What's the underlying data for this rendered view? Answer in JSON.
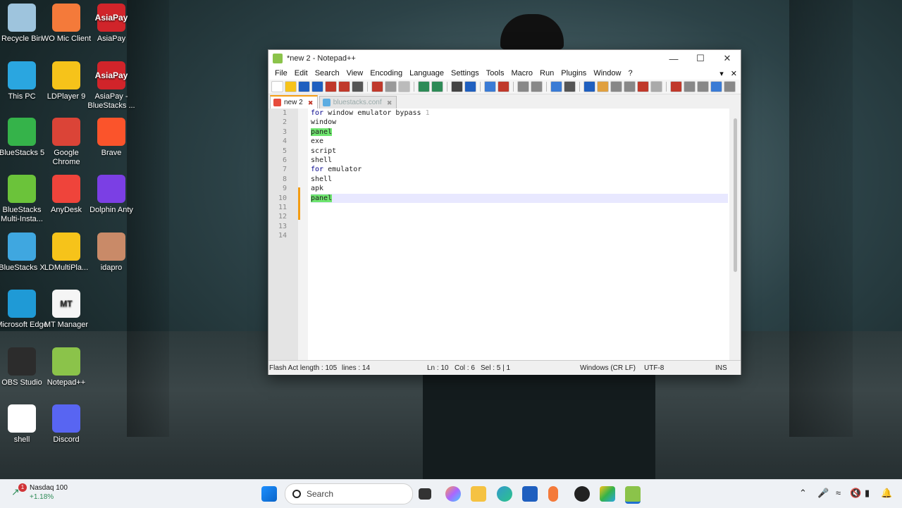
{
  "desktop": {
    "icons": [
      {
        "label": "Recycle Bin",
        "icon": "recycle-bin-icon",
        "color": "#9ec4dd"
      },
      {
        "label": "WO Mic Client",
        "icon": "wo-mic-icon",
        "color": "#f47a3a"
      },
      {
        "label": "AsiaPay",
        "icon": "asiapay-icon",
        "color": "#d1242a",
        "text": "AsiaPay"
      },
      {
        "label": "This PC",
        "icon": "this-pc-icon",
        "color": "#2aa6e0"
      },
      {
        "label": "LDPlayer 9",
        "icon": "ldplayer-icon",
        "color": "#f6c31a"
      },
      {
        "label": "AsiaPay - BlueStacks ...",
        "icon": "asiapay-bluestacks-icon",
        "color": "#d1242a",
        "text": "AsiaPay"
      },
      {
        "label": "BlueStacks 5",
        "icon": "bluestacks-icon",
        "color": "#35b34a"
      },
      {
        "label": "Google Chrome",
        "icon": "chrome-icon",
        "color": "#db4437"
      },
      {
        "label": "Brave",
        "icon": "brave-icon",
        "color": "#fb542b"
      },
      {
        "label": "BlueStacks Multi-Insta...",
        "icon": "bluestacks-multi-icon",
        "color": "#6bc33a"
      },
      {
        "label": "AnyDesk",
        "icon": "anydesk-icon",
        "color": "#ef443b"
      },
      {
        "label": "Dolphin Anty",
        "icon": "dolphin-anty-icon",
        "color": "#7b3fe4"
      },
      {
        "label": "BlueStacks X",
        "icon": "bluestacks-x-icon",
        "color": "#3fa7e0"
      },
      {
        "label": "LDMultiPla...",
        "icon": "ldmultiplayer-icon",
        "color": "#f6c31a"
      },
      {
        "label": "idapro",
        "icon": "idapro-icon",
        "color": "#c98a68"
      },
      {
        "label": "Microsoft Edge",
        "icon": "edge-icon",
        "color": "#1f9ad6"
      },
      {
        "label": "MT Manager",
        "icon": "mt-manager-icon",
        "color": "#f5f5f5",
        "text": "MT"
      },
      {
        "label": "OBS Studio",
        "icon": "obs-icon",
        "color": "#2c2c2c"
      },
      {
        "label": "Notepad++",
        "icon": "notepadpp-icon",
        "color": "#8bc34a"
      },
      {
        "label": "shell",
        "icon": "shell-file-icon",
        "color": "#ffffff"
      },
      {
        "label": "Discord",
        "icon": "discord-icon",
        "color": "#5865f2"
      }
    ]
  },
  "window": {
    "title": "*new 2 - Notepad++",
    "menu": [
      "File",
      "Edit",
      "Search",
      "View",
      "Encoding",
      "Language",
      "Settings",
      "Tools",
      "Macro",
      "Run",
      "Plugins",
      "Window",
      "?"
    ],
    "tabs": [
      {
        "label": "new 2",
        "active": true
      },
      {
        "label": "bluestacks.conf",
        "active": false
      }
    ],
    "lines": [
      {
        "n": "1",
        "kw": "for",
        "text": " window emulator bypass ",
        "tail": "1"
      },
      {
        "n": "2",
        "text": "window"
      },
      {
        "n": "3",
        "hl": "panel"
      },
      {
        "n": "4",
        "text": "exe"
      },
      {
        "n": "5",
        "text": "script"
      },
      {
        "n": "6",
        "text": "shell"
      },
      {
        "n": "7",
        "kw": "for",
        "text": " emulator"
      },
      {
        "n": "8",
        "text": "shell"
      },
      {
        "n": "9",
        "text": "apk"
      },
      {
        "n": "10",
        "hl": "panel",
        "current": true
      },
      {
        "n": "11",
        "text": ""
      },
      {
        "n": "12",
        "text": ""
      },
      {
        "n": "13",
        "text": ""
      },
      {
        "n": "14",
        "text": ""
      }
    ],
    "status": {
      "length": "Flash Act length : 105",
      "lines": "lines : 14",
      "ln": "Ln : 10",
      "col": "Col : 6",
      "sel": "Sel : 5 | 1",
      "eol": "Windows (CR LF)",
      "encoding": "UTF-8",
      "mode": "INS"
    }
  },
  "taskbar": {
    "widget_title": "Nasdaq 100",
    "widget_value": "+1.18%",
    "widget_badge": "1",
    "search_placeholder": "Search"
  }
}
